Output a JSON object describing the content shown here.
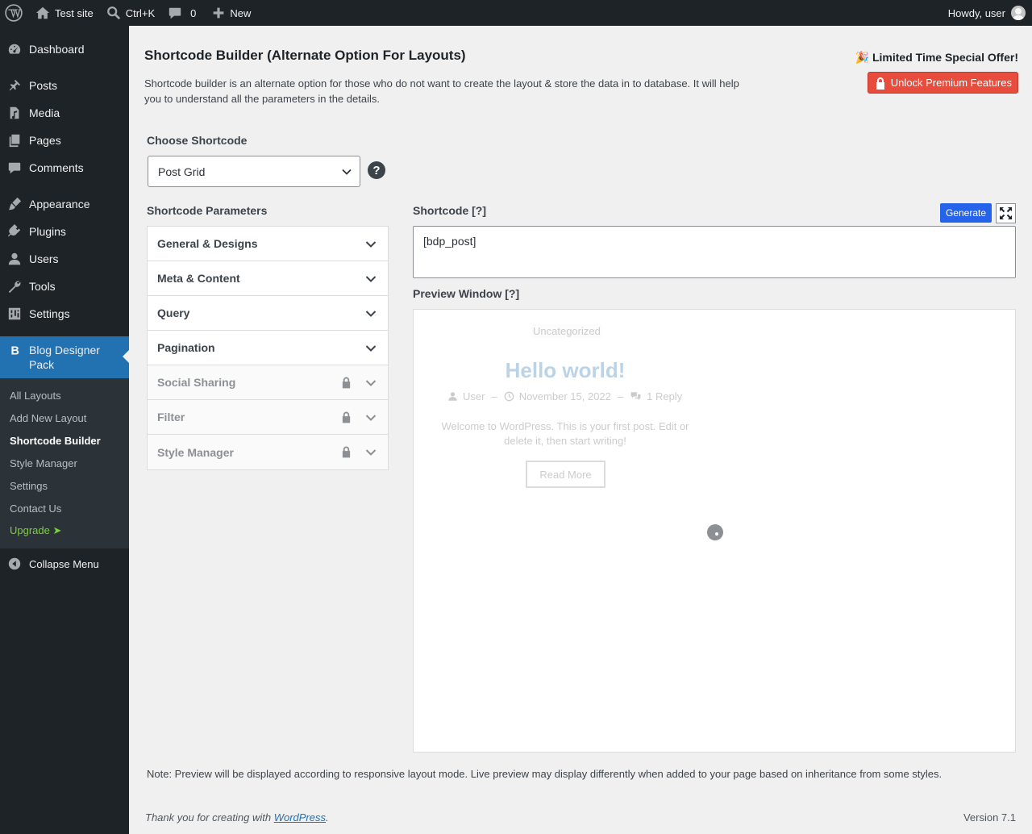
{
  "adminbar": {
    "site_name": "Test site",
    "search_shortcut": "Ctrl+K",
    "comments_count": "0",
    "new_label": "New",
    "howdy": "Howdy, user"
  },
  "sidebar": {
    "items": [
      {
        "label": "Dashboard",
        "icon": "dashboard-icon"
      },
      {
        "label": "Posts",
        "icon": "pin-icon"
      },
      {
        "label": "Media",
        "icon": "media-icon"
      },
      {
        "label": "Pages",
        "icon": "pages-icon"
      },
      {
        "label": "Comments",
        "icon": "comment-icon"
      },
      {
        "label": "Appearance",
        "icon": "brush-icon"
      },
      {
        "label": "Plugins",
        "icon": "plug-icon"
      },
      {
        "label": "Users",
        "icon": "user-icon"
      },
      {
        "label": "Tools",
        "icon": "wrench-icon"
      },
      {
        "label": "Settings",
        "icon": "settings-icon"
      }
    ],
    "current": {
      "label": "Blog Designer Pack",
      "icon": "b-icon"
    },
    "submenu": [
      "All Layouts",
      "Add New Layout",
      "Shortcode Builder",
      "Style Manager",
      "Settings",
      "Contact Us",
      "Upgrade ➤"
    ],
    "collapse": "Collapse Menu"
  },
  "header": {
    "title": "Shortcode Builder (Alternate Option For Layouts)",
    "description": "Shortcode builder is an alternate option for those who do not want to create the layout & store the data in to database. It will help you to understand all the parameters in the details.",
    "offer": "🎉 Limited Time Special Offer!",
    "unlock_label": "Unlock Premium Features"
  },
  "chooser": {
    "label": "Choose Shortcode",
    "selected": "Post Grid",
    "help": "?"
  },
  "params": {
    "label": "Shortcode Parameters",
    "sections": [
      {
        "label": "General & Designs",
        "locked": false
      },
      {
        "label": "Meta & Content",
        "locked": false
      },
      {
        "label": "Query",
        "locked": false
      },
      {
        "label": "Pagination",
        "locked": false
      },
      {
        "label": "Social Sharing",
        "locked": true
      },
      {
        "label": "Filter",
        "locked": true
      },
      {
        "label": "Style Manager",
        "locked": true
      }
    ]
  },
  "shortcode": {
    "label": "Shortcode [?]",
    "generate_label": "Generate",
    "value": "[bdp_post]"
  },
  "preview": {
    "label": "Preview Window [?]",
    "category": "Uncategorized",
    "post_title": "Hello world!",
    "author": "User",
    "date": "November 15, 2022",
    "comments": "1 Reply",
    "excerpt": "Welcome to WordPress. This is your first post. Edit or delete it, then start writing!",
    "read_more": "Read More"
  },
  "note": "Note: Preview will be displayed according to responsive layout mode. Live preview may display differently when added to your page based on inheritance from some styles.",
  "footer": {
    "thanks_prefix": "Thank you for creating with ",
    "thanks_link": "WordPress",
    "thanks_suffix": ".",
    "version": "Version 7.1"
  }
}
